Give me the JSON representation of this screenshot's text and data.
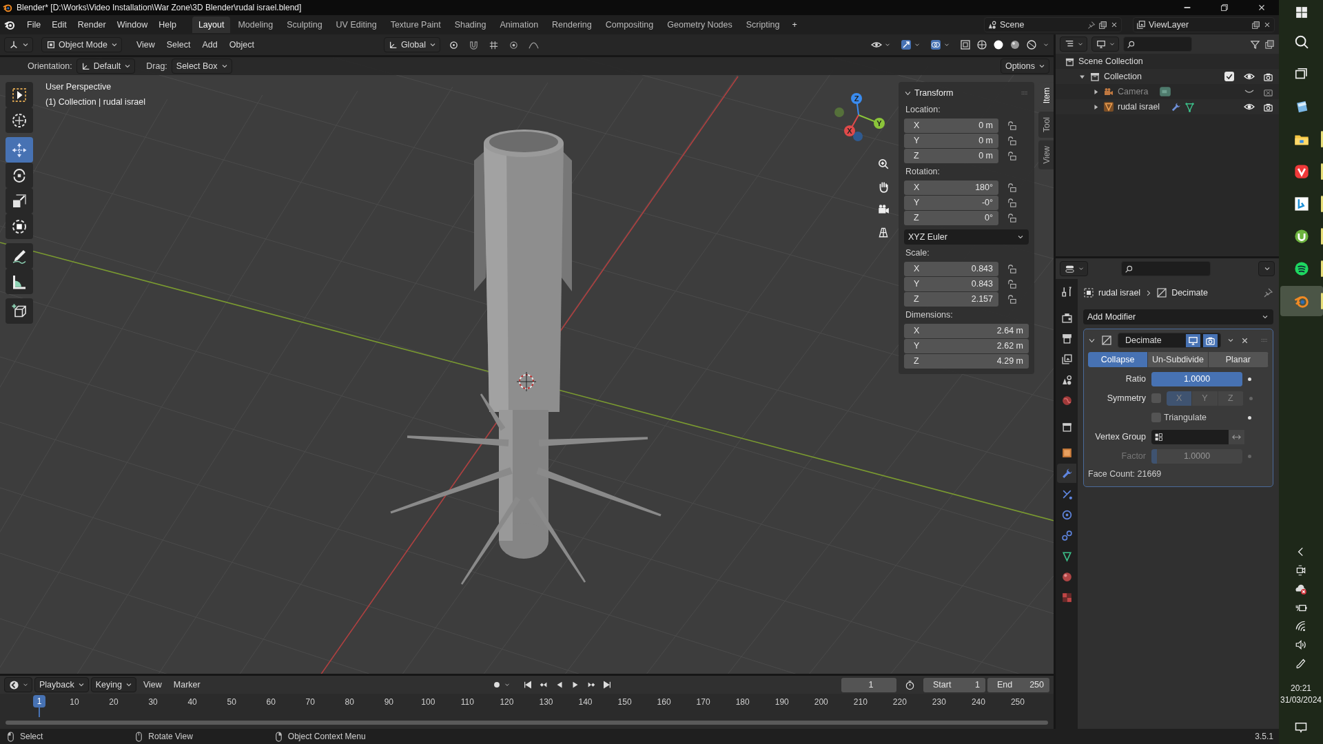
{
  "window": {
    "title": "Blender* [D:\\Works\\Video Installation\\War Zone\\3D Blender\\rudal israel.blend]"
  },
  "menu": [
    "File",
    "Edit",
    "Render",
    "Window",
    "Help"
  ],
  "workspaces": [
    {
      "label": "Layout",
      "selected": true
    },
    {
      "label": "Modeling",
      "selected": false
    },
    {
      "label": "Sculpting",
      "selected": false
    },
    {
      "label": "UV Editing",
      "selected": false
    },
    {
      "label": "Texture Paint",
      "selected": false
    },
    {
      "label": "Shading",
      "selected": false
    },
    {
      "label": "Animation",
      "selected": false
    },
    {
      "label": "Rendering",
      "selected": false
    },
    {
      "label": "Compositing",
      "selected": false
    },
    {
      "label": "Geometry Nodes",
      "selected": false
    },
    {
      "label": "Scripting",
      "selected": false
    }
  ],
  "add_workspace": "+",
  "scene": "Scene",
  "view_layer": "ViewLayer",
  "viewport_header": {
    "mode": "Object Mode",
    "menus": [
      "View",
      "Select",
      "Add",
      "Object"
    ],
    "orientation": "Global"
  },
  "tool_settings": {
    "orientation_label": "Orientation:",
    "orientation": "Default",
    "drag_label": "Drag:",
    "drag": "Select Box",
    "options": "Options"
  },
  "viewport": {
    "view_name": "User Perspective",
    "info": "(1) Collection | rudal israel",
    "tools": [
      {
        "kind": "select",
        "selected": false
      },
      {
        "kind": "cursor",
        "selected": false
      },
      {
        "kind": "move",
        "selected": true
      },
      {
        "kind": "rotate",
        "selected": false
      },
      {
        "kind": "scale",
        "selected": false
      },
      {
        "kind": "transform",
        "selected": false
      },
      {
        "kind": "annotate",
        "selected": false
      },
      {
        "kind": "measure",
        "selected": false
      },
      {
        "kind": "add-cube",
        "selected": false
      }
    ],
    "gizmo": [
      "X",
      "Y",
      "Z"
    ]
  },
  "sidebar": {
    "tabs": [
      {
        "label": "Item",
        "selected": true
      },
      {
        "label": "Tool",
        "selected": false
      },
      {
        "label": "View",
        "selected": false
      }
    ],
    "panel": {
      "title": "Transform",
      "expanded": true,
      "groups": [
        {
          "label": "Location:",
          "lockable": true,
          "fields": [
            {
              "axis": "X",
              "value": "0 m"
            },
            {
              "axis": "Y",
              "value": "0 m"
            },
            {
              "axis": "Z",
              "value": "0 m"
            }
          ]
        },
        {
          "label": "Rotation:",
          "lockable": true,
          "fields": [
            {
              "axis": "X",
              "value": "180°"
            },
            {
              "axis": "Y",
              "value": "-0°"
            },
            {
              "axis": "Z",
              "value": "0°"
            }
          ],
          "mode": "XYZ Euler"
        },
        {
          "label": "Scale:",
          "lockable": true,
          "fields": [
            {
              "axis": "X",
              "value": "0.843"
            },
            {
              "axis": "Y",
              "value": "0.843"
            },
            {
              "axis": "Z",
              "value": "2.157"
            }
          ]
        },
        {
          "label": "Dimensions:",
          "lockable": false,
          "fields": [
            {
              "axis": "X",
              "value": "2.64 m"
            },
            {
              "axis": "Y",
              "value": "2.62 m"
            },
            {
              "axis": "Z",
              "value": "4.29 m"
            }
          ]
        }
      ]
    }
  },
  "outliner": {
    "root": {
      "label": "Scene Collection",
      "children": [
        {
          "label": "Collection",
          "kind": "collection",
          "expanded": true,
          "checked": true,
          "visible": true,
          "children": [
            {
              "label": "Camera",
              "kind": "camera",
              "expanded": false,
              "visible": false
            },
            {
              "label": "rudal israel",
              "kind": "mesh",
              "expanded": false,
              "visible": true
            }
          ]
        }
      ]
    }
  },
  "properties": {
    "tabs": [
      {
        "kind": "tool",
        "selected": false
      },
      {
        "kind": "render",
        "selected": false
      },
      {
        "kind": "output",
        "selected": false
      },
      {
        "kind": "view-layer",
        "selected": false
      },
      {
        "kind": "scene",
        "selected": false
      },
      {
        "kind": "world",
        "selected": false
      },
      {
        "kind": "collection",
        "selected": false
      },
      {
        "kind": "object",
        "selected": false
      },
      {
        "kind": "modifier",
        "selected": true
      },
      {
        "kind": "particles",
        "selected": false
      },
      {
        "kind": "physics",
        "selected": false
      },
      {
        "kind": "constraints",
        "selected": false
      },
      {
        "kind": "data",
        "selected": false
      },
      {
        "kind": "material",
        "selected": false
      },
      {
        "kind": "texture",
        "selected": false
      }
    ],
    "object": "rudal israel",
    "breadcrumb_modifier": "Decimate",
    "add_modifier": "Add Modifier",
    "modifier": {
      "name": "Decimate",
      "expanded": true,
      "show_viewport": true,
      "show_render": true,
      "modes": [
        {
          "label": "Collapse",
          "selected": true
        },
        {
          "label": "Un-Subdivide",
          "selected": false
        },
        {
          "label": "Planar",
          "selected": false
        }
      ],
      "ratio": {
        "label": "Ratio",
        "value": "1.0000",
        "level": 1
      },
      "symmetry": {
        "label": "Symmetry",
        "checked": false,
        "axes": [
          {
            "label": "X",
            "selected": true
          },
          {
            "label": "Y",
            "selected": false
          },
          {
            "label": "Z",
            "selected": false
          }
        ]
      },
      "triangulate": {
        "label": "Triangulate",
        "checked": false
      },
      "vertex_group": {
        "label": "Vertex Group"
      },
      "factor": {
        "label": "Factor",
        "value": "1.0000",
        "level": 0.06,
        "disabled": true
      },
      "face_count": "Face Count: 21669"
    }
  },
  "timeline": {
    "menus": [
      "Playback",
      "Keying",
      "View",
      "Marker"
    ],
    "frame": "1",
    "start_label": "Start",
    "start": "1",
    "end_label": "End",
    "end": "250",
    "current": "1",
    "ruler": [
      "10",
      "20",
      "30",
      "40",
      "50",
      "60",
      "70",
      "80",
      "90",
      "100",
      "110",
      "120",
      "130",
      "140",
      "150",
      "160",
      "170",
      "180",
      "190",
      "200",
      "210",
      "220",
      "230",
      "240",
      "250"
    ]
  },
  "status_bar": {
    "hints": [
      "Select",
      "Rotate View",
      "Object Context Menu"
    ],
    "version": "3.5.1"
  },
  "taskbar": {
    "apps": [
      {
        "kind": "start",
        "running": false,
        "selected": false
      },
      {
        "kind": "search",
        "running": false,
        "selected": false
      },
      {
        "kind": "task-view",
        "running": false,
        "selected": false
      },
      {
        "kind": "notes",
        "running": false,
        "selected": false
      },
      {
        "kind": "explorer",
        "running": true,
        "selected": false
      },
      {
        "kind": "vivaldi",
        "running": true,
        "selected": false
      },
      {
        "kind": "bing",
        "running": true,
        "selected": false
      },
      {
        "kind": "utorrent",
        "running": true,
        "selected": false
      },
      {
        "kind": "spotify",
        "running": true,
        "selected": false
      },
      {
        "kind": "blender",
        "running": true,
        "selected": true
      }
    ],
    "tray": [
      {
        "kind": "chevron"
      },
      {
        "kind": "meet"
      },
      {
        "kind": "cloud-error"
      },
      {
        "kind": "battery"
      },
      {
        "kind": "wifi"
      },
      {
        "kind": "volume"
      },
      {
        "kind": "pen"
      }
    ],
    "time": "20:21",
    "date": "31/03/2024"
  }
}
